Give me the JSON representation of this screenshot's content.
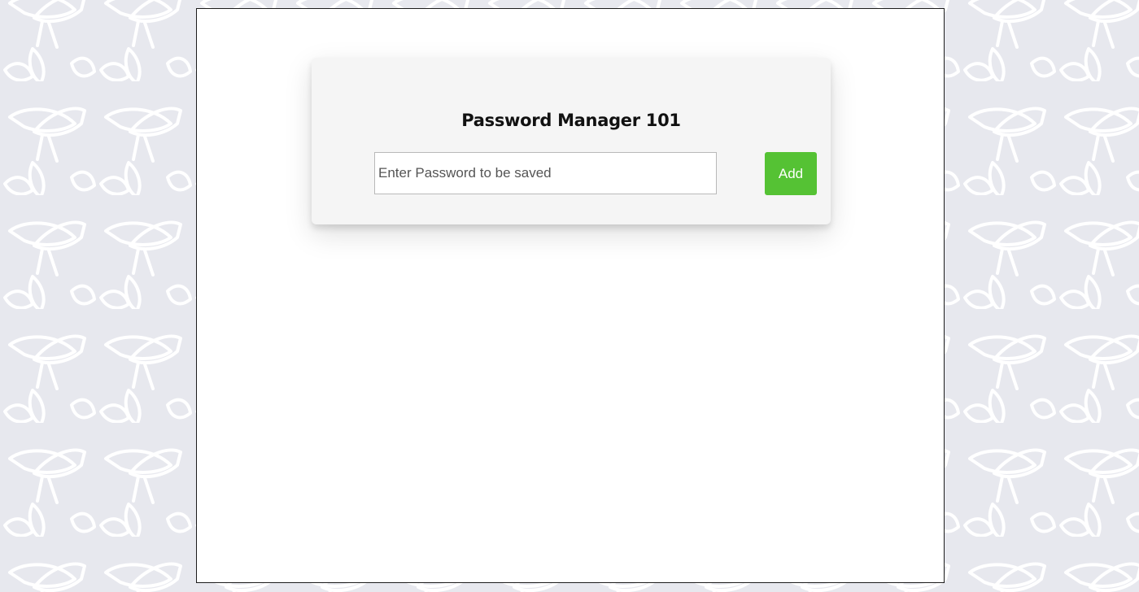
{
  "app": {
    "title": "Password Manager 101"
  },
  "form": {
    "password_input": {
      "value": "",
      "placeholder": "Enter Password to be saved"
    },
    "add_button_label": "Add"
  },
  "colors": {
    "page_background": "#e7e8ee",
    "pattern_stroke": "#ffffff",
    "card_background": "#f5f5f5",
    "add_button": "#55c234",
    "frame_border": "#1c1c1c"
  },
  "background_pattern": {
    "motif": "stylized-bee-outline"
  }
}
